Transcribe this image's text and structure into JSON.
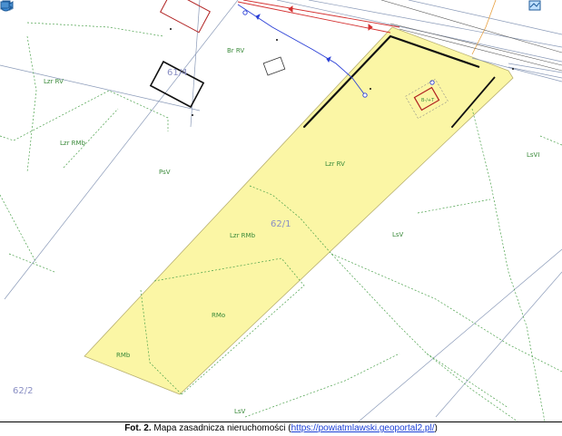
{
  "map": {
    "parcels": {
      "main": "62/1",
      "southwest": "62/2",
      "northwest_partial": "61/4"
    },
    "landuse_labels": {
      "lzr_rv_top_left": "Lzr RV",
      "lzr_rmb_left": "Lzr RMb",
      "br_rv": "Br RV",
      "psv": "PsV",
      "lzr_rv_main": "Lzr RV",
      "lzr_rmb_main": "Lzr RMb",
      "rmo": "RMo",
      "rmb": "RMb",
      "lsv": "LsV",
      "lsvi": "LsVI",
      "lsv_bottom": "LsV",
      "bi_label": "B-/+T"
    },
    "colors": {
      "parcel_fill": "#fbf6a5",
      "parcel_border": "#c9c27a",
      "landuse_green": "#3a8a3a",
      "utility_red": "#d43030",
      "utility_blue": "#2a3fd6",
      "boundary_black": "#111111"
    },
    "icons": [
      "measure-icon",
      "print-icon",
      "globe-icon",
      "camera-icon",
      "window-icon",
      "map-icon"
    ]
  },
  "caption": {
    "prefix": "Fot. 2.",
    "text": " Mapa zasadnicza nieruchomości (",
    "link": "https://powiatmlawski.geoportal2.pl/",
    "suffix": ")"
  }
}
